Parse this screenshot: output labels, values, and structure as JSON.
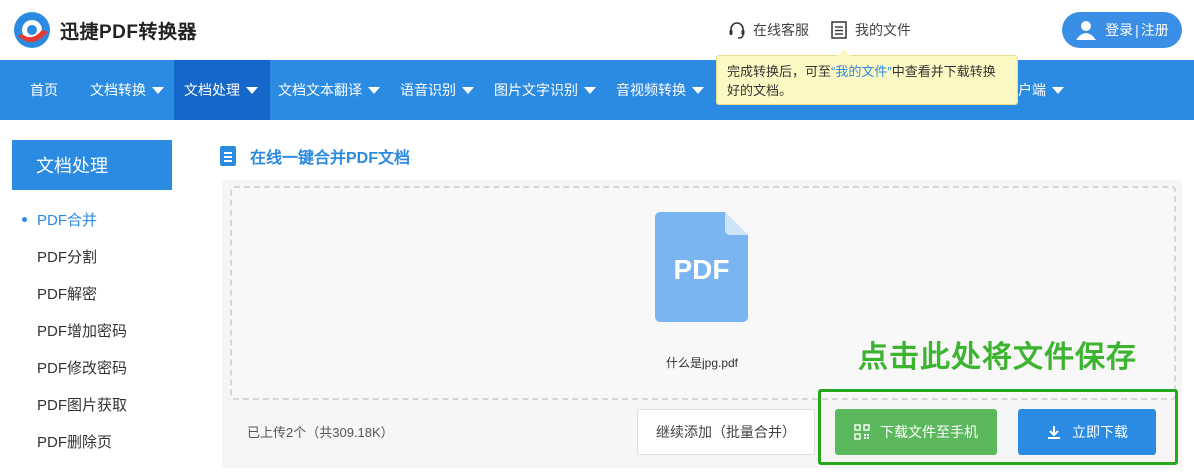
{
  "header": {
    "logo_text": "迅捷PDF转换器",
    "online_service": "在线客服",
    "my_files": "我的文件",
    "login_label": "登录",
    "separator": "|",
    "register_label": "注册"
  },
  "nav": {
    "items": [
      {
        "label": "首页",
        "dropdown": false,
        "active": false
      },
      {
        "label": "文档转换",
        "dropdown": true,
        "active": false
      },
      {
        "label": "文档处理",
        "dropdown": true,
        "active": true
      },
      {
        "label": "文档文本翻译",
        "dropdown": true,
        "active": false
      },
      {
        "label": "语音识别",
        "dropdown": true,
        "active": false
      },
      {
        "label": "图片文字识别",
        "dropdown": true,
        "active": false
      },
      {
        "label": "音视频转换",
        "dropdown": true,
        "active": false
      },
      {
        "label": "户端",
        "dropdown": true,
        "active": false
      }
    ]
  },
  "tooltip": {
    "text_before": "完成转换后，可至",
    "highlight": "“我的文件”",
    "text_after": "中查看并下载转换好的文档。"
  },
  "sidebar": {
    "title": "文档处理",
    "items": [
      {
        "label": "PDF合并",
        "active": true
      },
      {
        "label": "PDF分割",
        "active": false
      },
      {
        "label": "PDF解密",
        "active": false
      },
      {
        "label": "PDF增加密码",
        "active": false
      },
      {
        "label": "PDF修改密码",
        "active": false
      },
      {
        "label": "PDF图片获取",
        "active": false
      },
      {
        "label": "PDF删除页",
        "active": false
      }
    ]
  },
  "main": {
    "section_title": "在线一键合并PDF文档",
    "pdf_icon_text": "PDF",
    "file_name": "什么是jpg.pdf",
    "hint_text": "点击此处将文件保存",
    "upload_count": "已上传2个（共309.18K）",
    "add_button": "继续添加（批量合并）",
    "download_phone_button": "下载文件至手机",
    "download_button": "立即下载"
  },
  "colors": {
    "brand_blue": "#2b8ae2",
    "nav_active": "#1567c9",
    "hint_green": "#3cb42f",
    "phone_button": "#5cb85c",
    "tooltip_bg": "#fdf9c4"
  }
}
